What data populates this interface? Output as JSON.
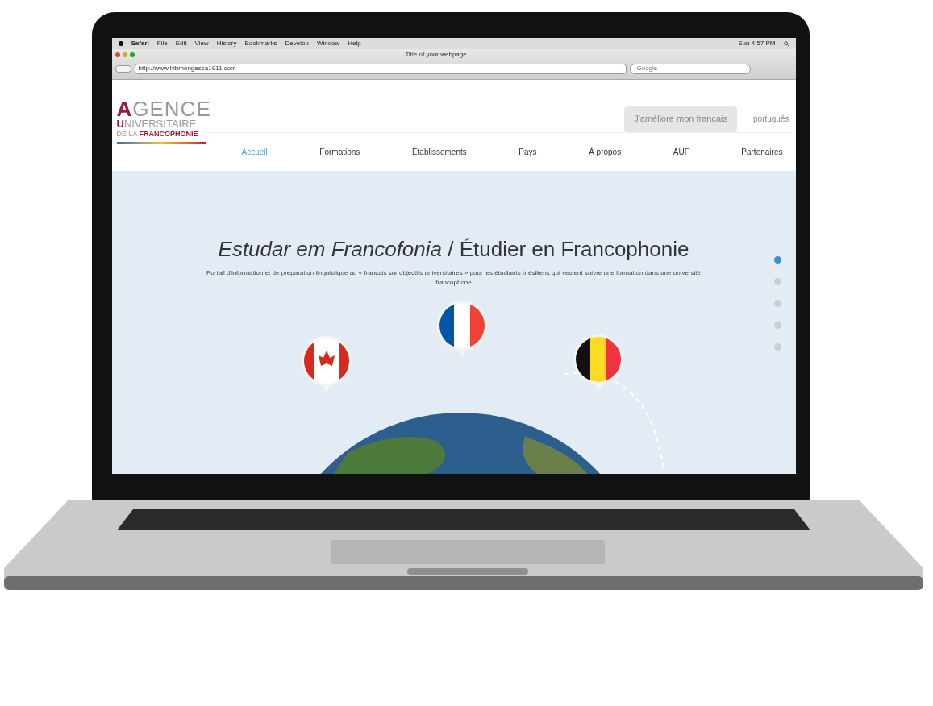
{
  "menu_bar": {
    "items": [
      "Safari",
      "File",
      "Edit",
      "View",
      "History",
      "Bookmarks",
      "Develop",
      "Window",
      "Help"
    ],
    "clock": "Sun 4:57 PM"
  },
  "browser": {
    "title": "Title of your webpage",
    "url": "http://www.hibmengessa1911.com",
    "search": {
      "placeholder": "Google"
    }
  },
  "site": {
    "logo": [
      {
        "initial": "A",
        "rest": "GENCE"
      },
      {
        "initial": "U",
        "rest": "NIVERSITAIRE"
      },
      {
        "initial": "DE LA ",
        "rest": "FRANCOPHONIE"
      }
    ],
    "cta": "J'améliore mon français",
    "language": "português",
    "nav": [
      {
        "label": "Accueil",
        "selected": true
      },
      {
        "label": "Formations",
        "selected": false
      },
      {
        "label": "Établissements",
        "selected": false
      },
      {
        "label": "Pays",
        "selected": false
      },
      {
        "label": "À propos",
        "selected": false
      },
      {
        "label": "AUF",
        "selected": false
      },
      {
        "label": "Partenaires",
        "selected": false
      }
    ]
  },
  "hero": {
    "title": "*Estudar em Francofonia* / Étudier en Francophonie",
    "subtitle": "Portail d'information et de préparation linguistique au « français sur objectifs universitaires » pour les étudiants brésiliens qui veulent suivre une formation dans une université francophone",
    "flags": [
      {
        "kind": "canada"
      },
      {
        "kind": "france"
      },
      {
        "kind": "belgium"
      }
    ],
    "slides": [
      {
        "selected": true
      },
      {
        "selected": false
      },
      {
        "selected": false
      },
      {
        "selected": false
      },
      {
        "selected": false
      }
    ]
  }
}
